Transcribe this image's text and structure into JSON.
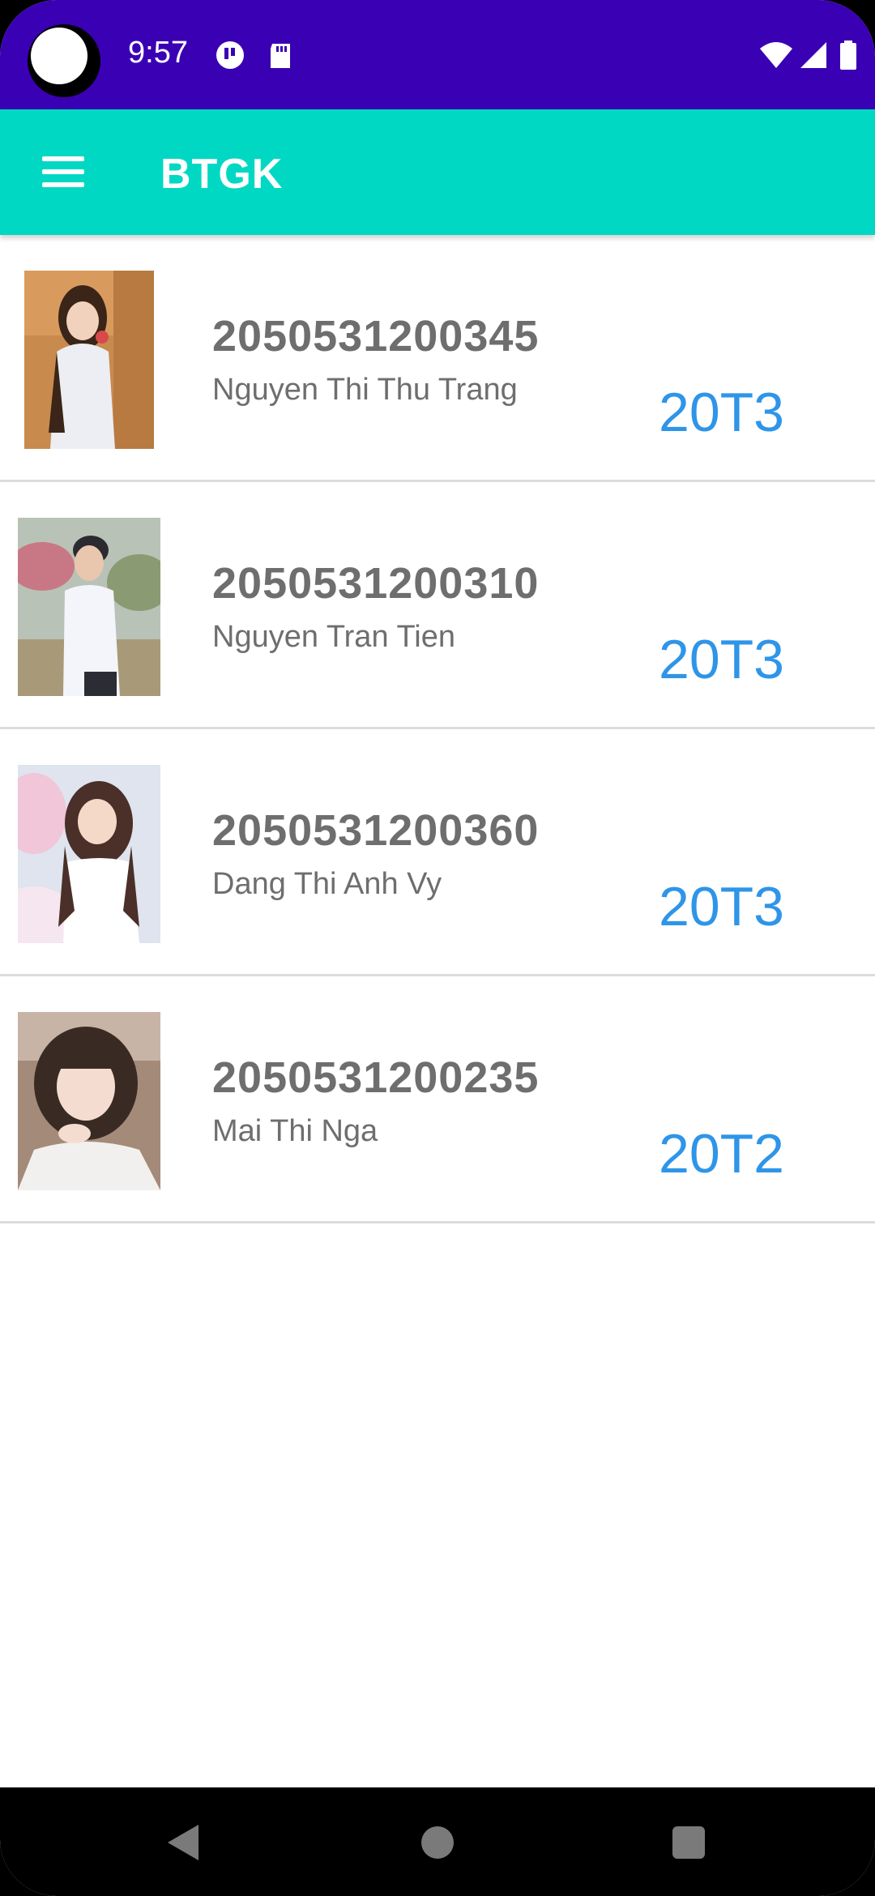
{
  "status_bar": {
    "time": "9:57",
    "icons_left": [
      "notification-icon",
      "sd-card-icon"
    ],
    "icons_right": [
      "wifi-icon",
      "signal-icon",
      "battery-icon"
    ],
    "background": "#3a00b4"
  },
  "app_bar": {
    "title": "BTGK",
    "menu_icon": "hamburger-menu-icon",
    "background": "#00d8c4"
  },
  "students": [
    {
      "id": "2050531200345",
      "name": "Nguyen Thi Thu Trang",
      "class": "20T3"
    },
    {
      "id": "2050531200310",
      "name": "Nguyen Tran Tien",
      "class": "20T3"
    },
    {
      "id": "2050531200360",
      "name": "Dang Thi Anh Vy",
      "class": "20T3"
    },
    {
      "id": "2050531200235",
      "name": "Mai Thi Nga",
      "class": "20T2"
    }
  ],
  "colors": {
    "text_gray": "#6e6e6e",
    "class_blue": "#2e95e8",
    "divider": "#dcdcdc"
  },
  "nav_bar": {
    "buttons": [
      "back-icon",
      "home-icon",
      "recents-icon"
    ]
  }
}
